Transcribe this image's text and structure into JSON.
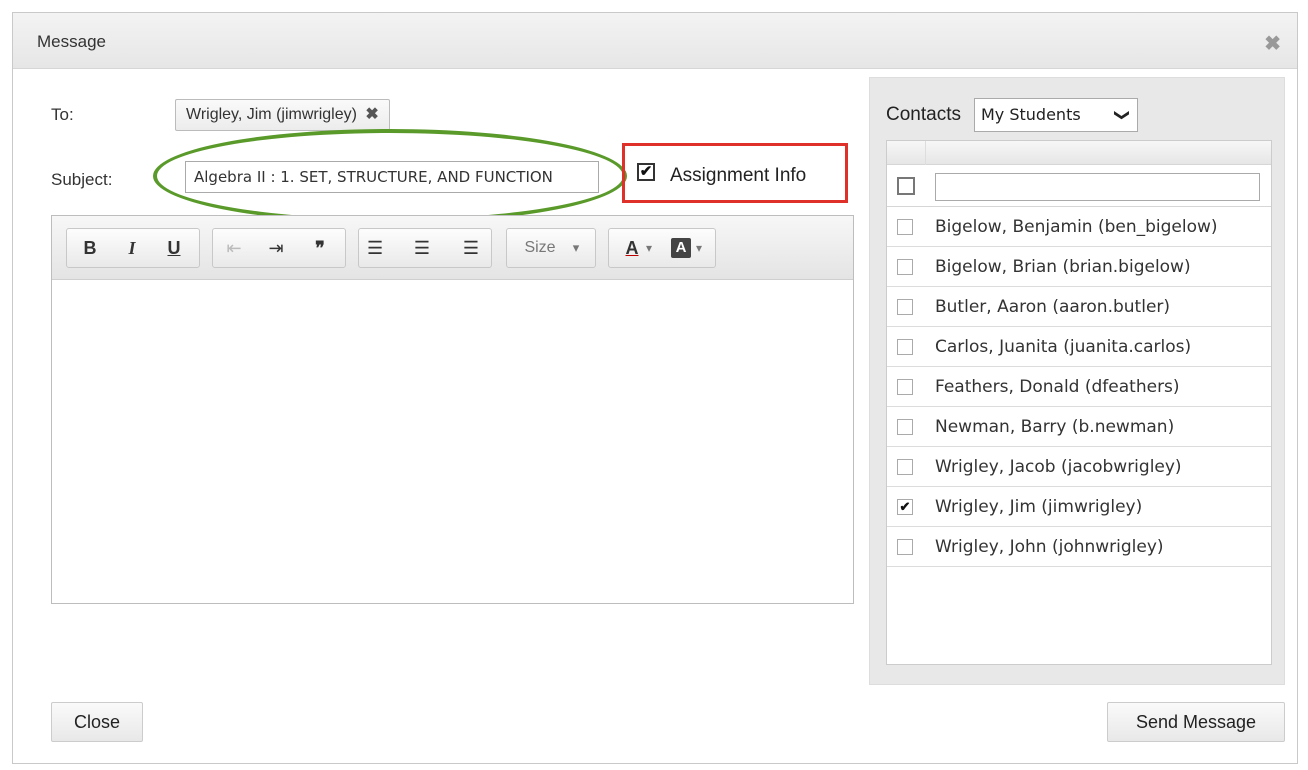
{
  "dialog": {
    "title": "Message",
    "close_icon": "close-icon"
  },
  "form": {
    "to_label": "To:",
    "to_recipient": "Wrigley, Jim (jimwrigley)",
    "to_remove_glyph": "✖",
    "subject_label": "Subject:",
    "subject_value": "Algebra II : 1. SET, STRUCTURE, AND FUNCTION",
    "assignment_info_label": "Assignment Info",
    "assignment_info_checked": true,
    "check_glyph": "✔"
  },
  "toolbar": {
    "bold": "B",
    "italic": "I",
    "underline": "U",
    "outdent": "⇤",
    "indent": "⇥",
    "blockquote": "❞",
    "align_left": "☰",
    "align_center": "☰",
    "align_right": "☰",
    "size_label": "Size",
    "dropdown_glyph": "▾",
    "text_color": "A",
    "bg_color": "A"
  },
  "contacts": {
    "label": "Contacts",
    "selected_group": "My Students",
    "chevron_glyph": "❯",
    "filter_placeholder": "",
    "items": [
      {
        "name": "Bigelow, Benjamin (ben_bigelow)",
        "checked": false
      },
      {
        "name": "Bigelow, Brian (brian.bigelow)",
        "checked": false
      },
      {
        "name": "Butler, Aaron (aaron.butler)",
        "checked": false
      },
      {
        "name": "Carlos, Juanita (juanita.carlos)",
        "checked": false
      },
      {
        "name": "Feathers, Donald (dfeathers)",
        "checked": false
      },
      {
        "name": "Newman, Barry (b.newman)",
        "checked": false
      },
      {
        "name": "Wrigley, Jacob (jacobwrigley)",
        "checked": false
      },
      {
        "name": "Wrigley, Jim (jimwrigley)",
        "checked": true
      },
      {
        "name": "Wrigley, John (johnwrigley)",
        "checked": false
      }
    ]
  },
  "buttons": {
    "close": "Close",
    "send": "Send Message"
  },
  "colors": {
    "annotation_green": "#5a9a2a",
    "annotation_red": "#e0302a"
  }
}
